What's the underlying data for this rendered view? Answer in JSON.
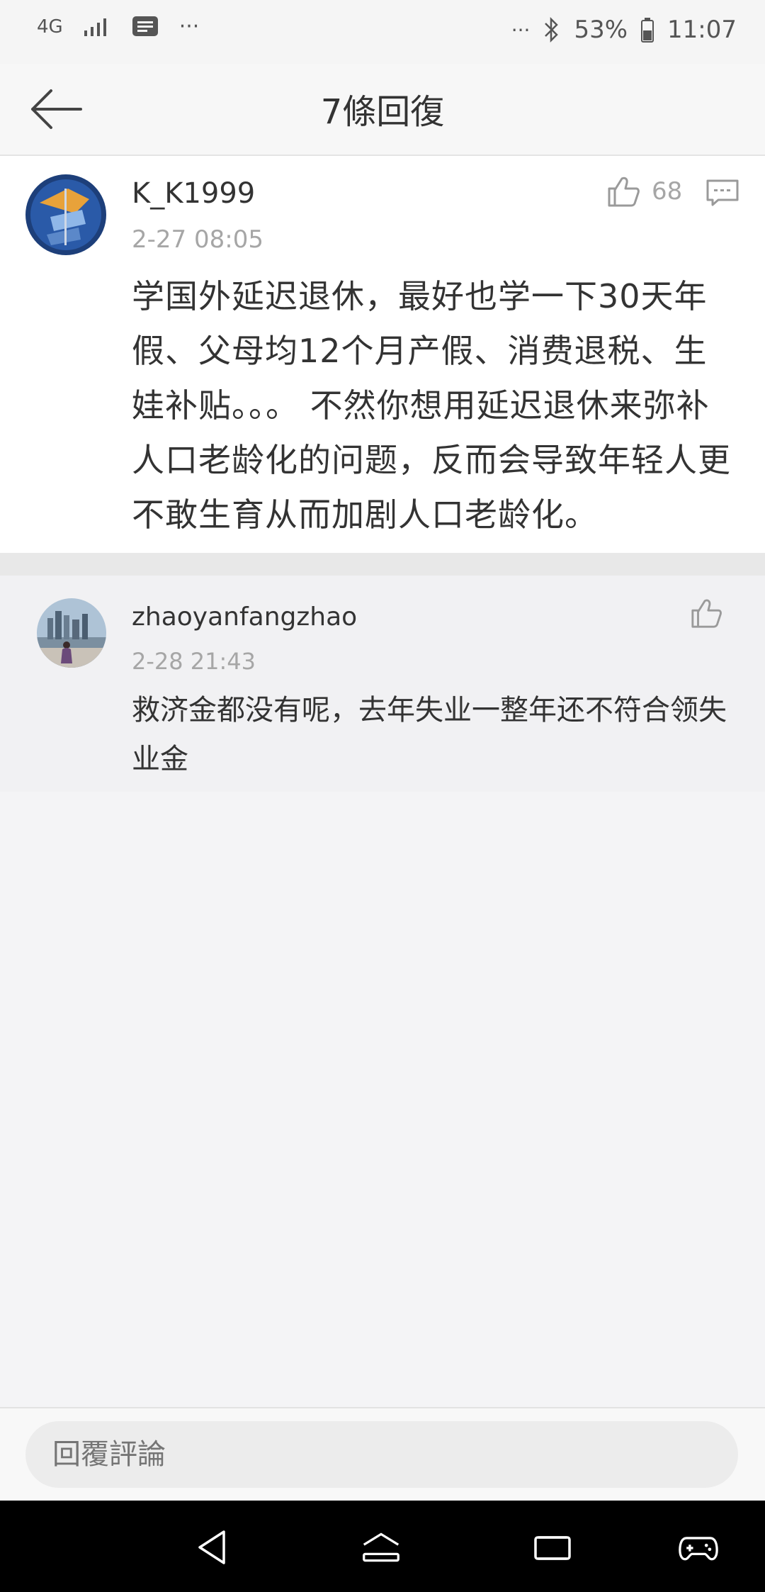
{
  "status_bar": {
    "network": "4G",
    "dots_left": "···",
    "dots_right": "···",
    "battery": "53%",
    "time": "11:07"
  },
  "header": {
    "title": "7條回復"
  },
  "main_comment": {
    "username": "K_K1999",
    "timestamp": "2-27 08:05",
    "likes": "68",
    "text": "学国外延迟退休，最好也学一下30天年假、父母均12个月产假、消费退税、生娃补贴。。。 不然你想用延迟退休来弥补人口老龄化的问题，反而会导致年轻人更不敢生育从而加剧人口老龄化。"
  },
  "reply": {
    "username": "zhaoyanfangzhao",
    "timestamp": "2-28 21:43",
    "text": "救济金都没有呢，去年失业一整年还不符合领失业金"
  },
  "input": {
    "placeholder": "回覆評論"
  },
  "icons": {
    "back": "back-arrow-icon",
    "like": "thumbs-up-icon",
    "reply": "comment-icon",
    "nav_back": "nav-back-icon",
    "nav_home": "nav-home-icon",
    "nav_recents": "nav-recents-icon",
    "nav_game": "gamepad-icon"
  },
  "colors": {
    "background": "#f4f4f6",
    "card": "#ffffff",
    "muted_text": "#a6a6a6",
    "navbar": "#000000"
  }
}
